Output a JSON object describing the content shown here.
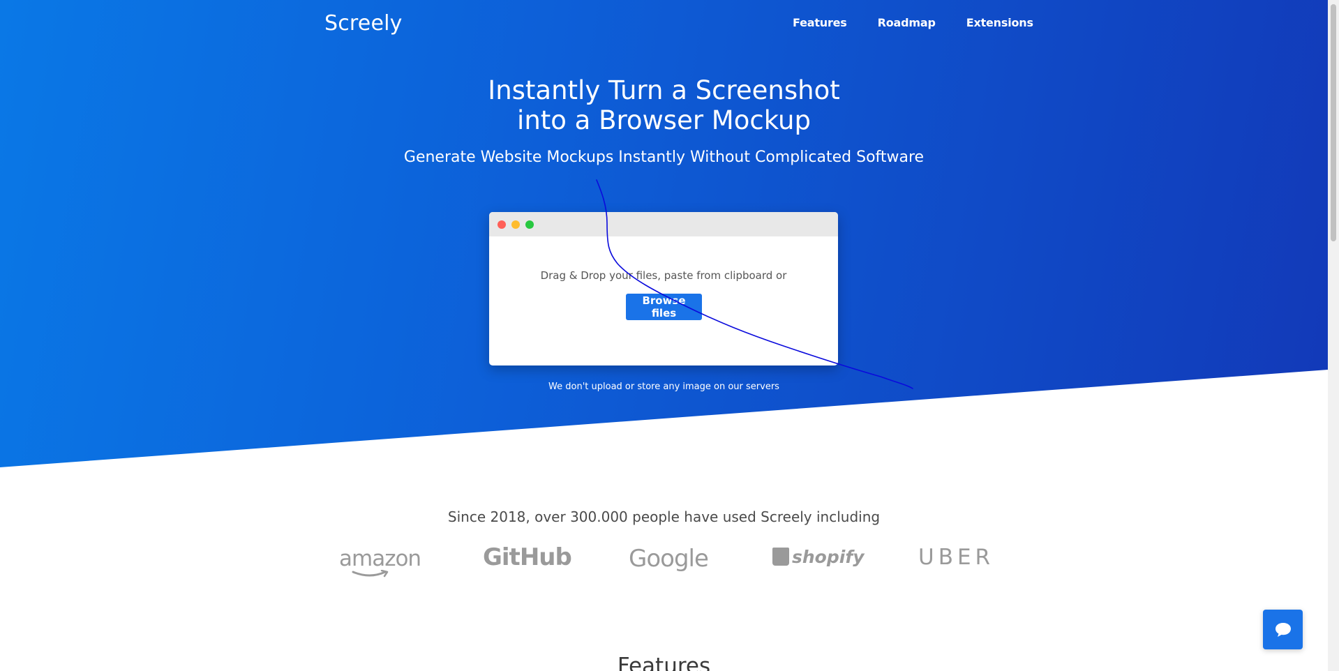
{
  "nav": {
    "brand": "Screely",
    "links": [
      "Features",
      "Roadmap",
      "Extensions"
    ]
  },
  "hero": {
    "title_line1": "Instantly Turn a Screenshot",
    "title_line2": "into a Browser Mockup",
    "subtitle": "Generate Website Mockups Instantly Without Complicated Software",
    "drop_text": "Drag & Drop your files, paste from clipboard or",
    "browse_label": "Browse files",
    "privacy_note": "We don't upload or store any image on our servers"
  },
  "social_proof": {
    "headline": "Since 2018, over 300.000 people have used Screely including",
    "logos": [
      "amazon",
      "GitHub",
      "Google",
      "shopify",
      "UBER"
    ]
  },
  "features": {
    "heading": "Features"
  },
  "icons": {
    "chat": "chat-bubble-icon"
  },
  "colors": {
    "hero_start": "#0a78e6",
    "hero_end": "#1239b8",
    "button": "#1a73e8",
    "logo_gray": "#9a9a9a",
    "scribble": "#0a0adc"
  }
}
